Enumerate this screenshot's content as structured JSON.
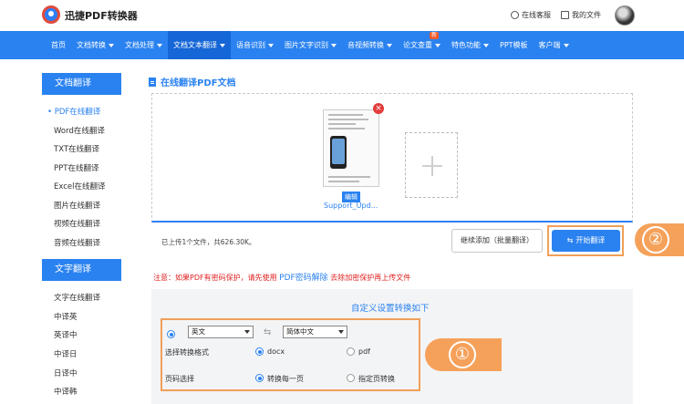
{
  "header": {
    "logo_text": "迅捷PDF转换器",
    "service_label": "在线客服",
    "my_files_label": "我的文件"
  },
  "nav": {
    "items": [
      {
        "label": "首页"
      },
      {
        "label": "文档转换"
      },
      {
        "label": "文档处理"
      },
      {
        "label": "文档文本翻译"
      },
      {
        "label": "语音识别"
      },
      {
        "label": "图片文字识别"
      },
      {
        "label": "音视频转换"
      },
      {
        "label": "论文查重"
      },
      {
        "label": "特色功能"
      },
      {
        "label": "PPT模板"
      },
      {
        "label": "客户端"
      }
    ],
    "new_badge": "新"
  },
  "sidebar": {
    "section1_title": "文档翻译",
    "section1_items": [
      "PDF在线翻译",
      "Word在线翻译",
      "TXT在线翻译",
      "PPT在线翻译",
      "Excel在线翻译",
      "图片在线翻译",
      "视频在线翻译",
      "音频在线翻译"
    ],
    "section2_title": "文字翻译",
    "section2_items": [
      "文字在线翻译",
      "中译英",
      "英译中",
      "中译日",
      "日译中",
      "中译韩"
    ]
  },
  "main": {
    "page_title": "在线翻译PDF文档",
    "file": {
      "edit_label": "编辑",
      "name": "Support_Upd..."
    },
    "upload_status": "已上传1个文件，共626.30K。",
    "continue_button": "继续添加（批量翻译）",
    "start_button": "开始翻译",
    "notice_prefix": "注意：如果PDF有密码保护，请先使用",
    "notice_link": "PDF密码解除",
    "notice_suffix": "去除加密保护再上传文件",
    "settings": {
      "title": "自定义设置转换如下",
      "source_lang": "英文",
      "target_lang": "简体中文",
      "format_label": "选择转换格式",
      "format_options": [
        "docx",
        "pdf"
      ],
      "format_selected": "docx",
      "page_label": "页码选择",
      "page_options": [
        "转换每一页",
        "指定页转换"
      ],
      "page_selected": "转换每一页"
    }
  },
  "callouts": [
    "①",
    "②"
  ],
  "colors": {
    "primary": "#2a82f0",
    "highlight": "#f0a05a",
    "warning": "#e02020"
  }
}
